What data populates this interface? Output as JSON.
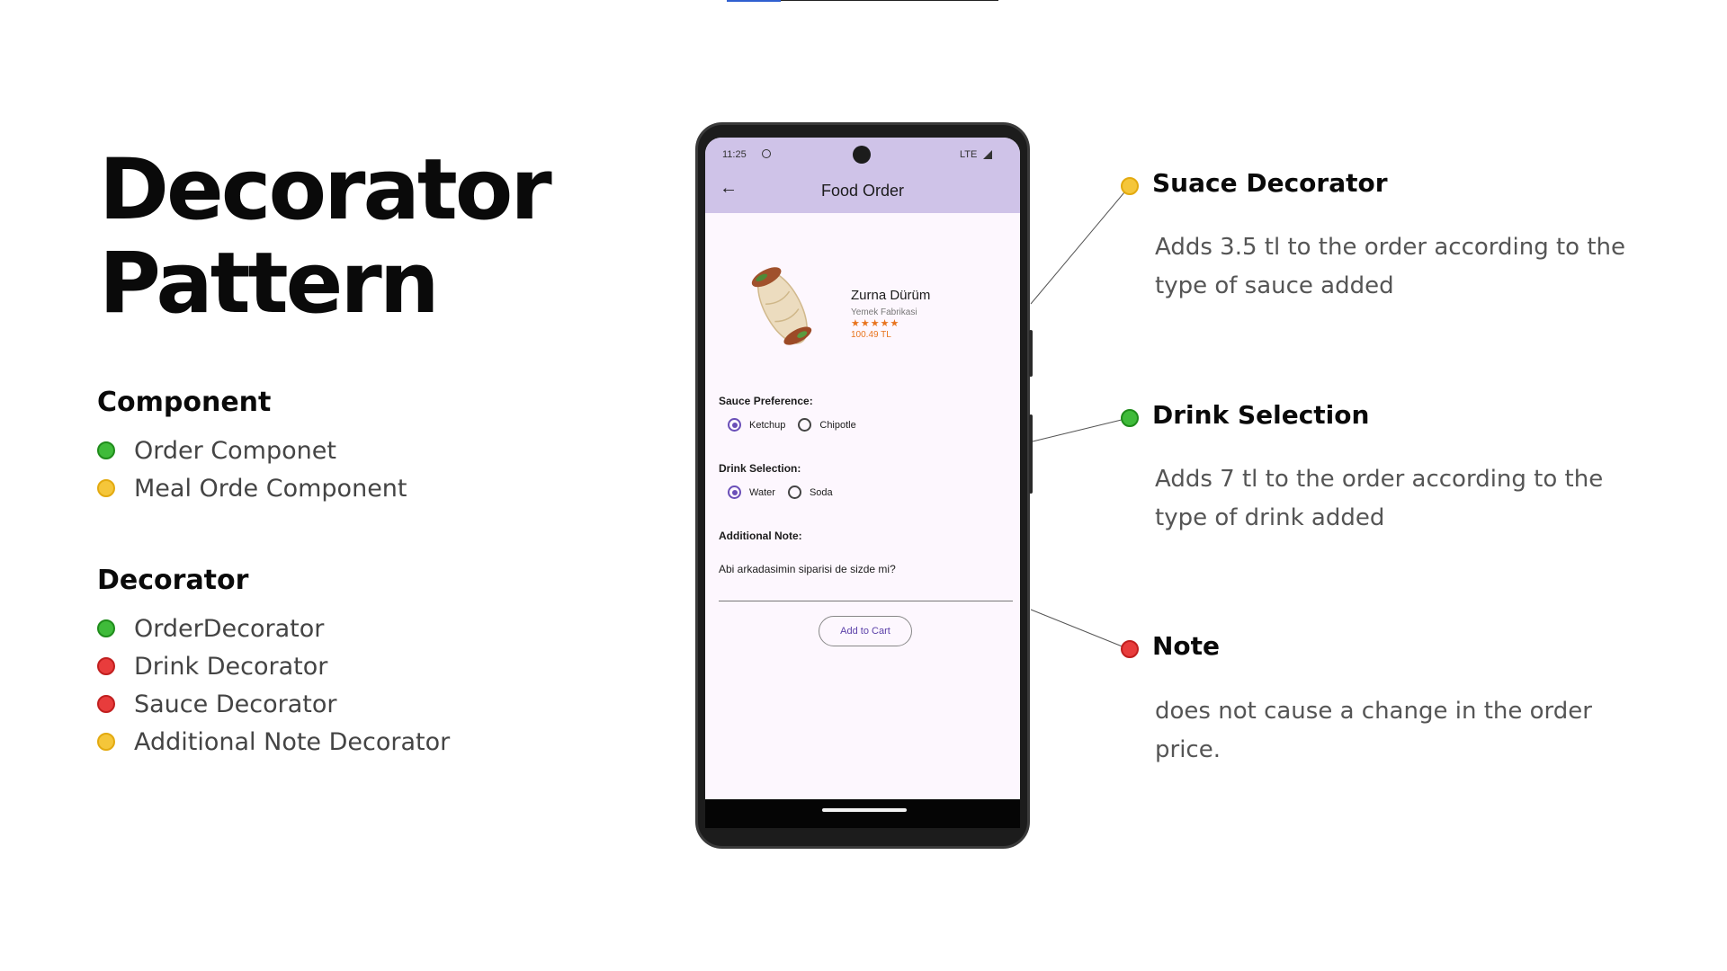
{
  "colors": {
    "green": "#3fbb3a",
    "yellow": "#f5c63a",
    "red": "#e83c3c",
    "accent": "#6a4fb8",
    "appbar": "#cfc3e8"
  },
  "title": {
    "line1": "Decorator",
    "line2": "Pattern"
  },
  "component": {
    "heading": "Component",
    "items": [
      {
        "label": "Order Componet",
        "color": "green"
      },
      {
        "label": "Meal Orde Component",
        "color": "yellow"
      }
    ]
  },
  "decorator": {
    "heading": "Decorator",
    "items": [
      {
        "label": "OrderDecorator",
        "color": "green"
      },
      {
        "label": "Drink Decorator",
        "color": "red"
      },
      {
        "label": "Sauce Decorator",
        "color": "red"
      },
      {
        "label": "Additional Note Decorator",
        "color": "yellow"
      }
    ]
  },
  "phone": {
    "status": {
      "time": "11:25",
      "network": "LTE"
    },
    "appbar": {
      "back_icon": "arrow-left-icon",
      "title": "Food Order"
    },
    "food": {
      "name": "Zurna Dürüm",
      "restaurant": "Yemek Fabrikasi",
      "stars": "★★★★★",
      "rating": 5,
      "price": "100.49 TL"
    },
    "sauce": {
      "label": "Sauce Preference:",
      "options": [
        "Ketchup",
        "Chipotle"
      ],
      "selected": "Ketchup"
    },
    "drink": {
      "label": "Drink Selection:",
      "options": [
        "Water",
        "Soda"
      ],
      "selected": "Water"
    },
    "note": {
      "label": "Additional Note:",
      "value": "Abi arkadasimin siparisi de sizde mi?"
    },
    "add_to_cart": "Add to Cart"
  },
  "annotations": [
    {
      "title": "Suace Decorator",
      "description": "Adds 3.5 tl to the order according to the type of sauce added",
      "color": "yellow"
    },
    {
      "title": "Drink Selection",
      "description": "Adds 7 tl to the order according to the type of drink added",
      "color": "green"
    },
    {
      "title": "Note",
      "description": "does not cause a change in the order price.",
      "color": "red"
    }
  ]
}
